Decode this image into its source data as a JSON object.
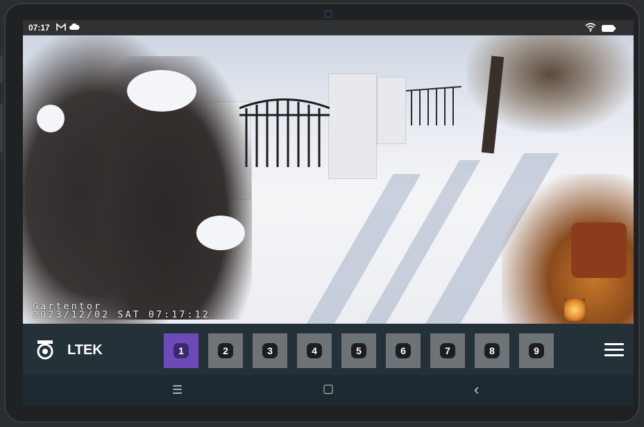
{
  "status_bar": {
    "time": "07:17",
    "notification_icons": [
      "mail-icon",
      "cloud-icon"
    ],
    "system_icons": [
      "wifi-icon",
      "battery-icon"
    ]
  },
  "camera_view": {
    "osd_label": "Gartentor",
    "osd_timestamp": "2023/12/02 SAT 07:17:12"
  },
  "control_bar": {
    "logo_icon": "camera-dome-icon",
    "brand": "LTEK",
    "channels": [
      {
        "label": "1",
        "active": true
      },
      {
        "label": "2",
        "active": false
      },
      {
        "label": "3",
        "active": false
      },
      {
        "label": "4",
        "active": false
      },
      {
        "label": "5",
        "active": false
      },
      {
        "label": "6",
        "active": false
      },
      {
        "label": "7",
        "active": false
      },
      {
        "label": "8",
        "active": false
      },
      {
        "label": "9",
        "active": false
      }
    ],
    "menu_icon": "hamburger-menu-icon"
  },
  "nav_bar": {
    "recents": "☰",
    "home": "▢",
    "back": "‹"
  },
  "colors": {
    "active_channel": "#6c4bb8",
    "inactive_channel": "#6e7377",
    "control_bar_bg": "#243139"
  }
}
